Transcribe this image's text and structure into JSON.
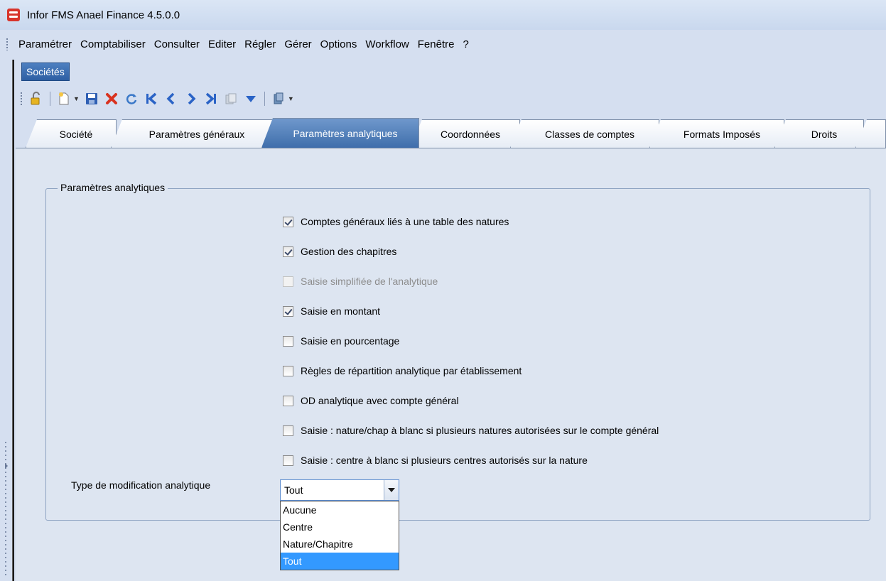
{
  "window": {
    "title": "Infor FMS Anael Finance 4.5.0.0"
  },
  "menu": [
    "Paramétrer",
    "Comptabiliser",
    "Consulter",
    "Editer",
    "Régler",
    "Gérer",
    "Options",
    "Workflow",
    "Fenêtre",
    "?"
  ],
  "document_tab": "Sociétés",
  "toolbar": {
    "icons": [
      "unlock-icon",
      "new-document-icon",
      "save-icon",
      "delete-icon",
      "refresh-icon",
      "first-record-icon",
      "previous-record-icon",
      "next-record-icon",
      "last-record-icon",
      "copy-icon",
      "filter-icon",
      "print-icon"
    ]
  },
  "tabs": [
    {
      "label": "Société",
      "active": false
    },
    {
      "label": "Paramètres généraux",
      "active": false
    },
    {
      "label": "Paramètres analytiques",
      "active": true
    },
    {
      "label": "Coordonnées",
      "active": false
    },
    {
      "label": "Classes de comptes",
      "active": false
    },
    {
      "label": "Formats Imposés",
      "active": false
    },
    {
      "label": "Droits",
      "active": false
    }
  ],
  "group": {
    "title": "Paramètres analytiques",
    "checkboxes": [
      {
        "label": "Comptes généraux liés à une table des natures",
        "checked": true,
        "enabled": true
      },
      {
        "label": "Gestion des chapitres",
        "checked": true,
        "enabled": true
      },
      {
        "label": "Saisie simplifiée de l'analytique",
        "checked": false,
        "enabled": false
      },
      {
        "label": "Saisie en montant",
        "checked": true,
        "enabled": true
      },
      {
        "label": "Saisie en pourcentage",
        "checked": false,
        "enabled": true
      },
      {
        "label": "Règles de répartition analytique par établissement",
        "checked": false,
        "enabled": true
      },
      {
        "label": "OD analytique avec compte général",
        "checked": false,
        "enabled": true
      },
      {
        "label": "Saisie : nature/chap à blanc si plusieurs natures autorisées sur le compte général",
        "checked": false,
        "enabled": true
      },
      {
        "label": "Saisie : centre à blanc si plusieurs centres autorisés sur la nature",
        "checked": false,
        "enabled": true
      }
    ],
    "combo": {
      "label": "Type de modification analytique",
      "value": "Tout",
      "options": [
        "Aucune",
        "Centre",
        "Nature/Chapitre",
        "Tout"
      ],
      "highlighted": "Tout"
    }
  },
  "colors": {
    "active_tab": "#4f7fbd",
    "background": "#dde5f1",
    "highlight": "#3399ff"
  }
}
